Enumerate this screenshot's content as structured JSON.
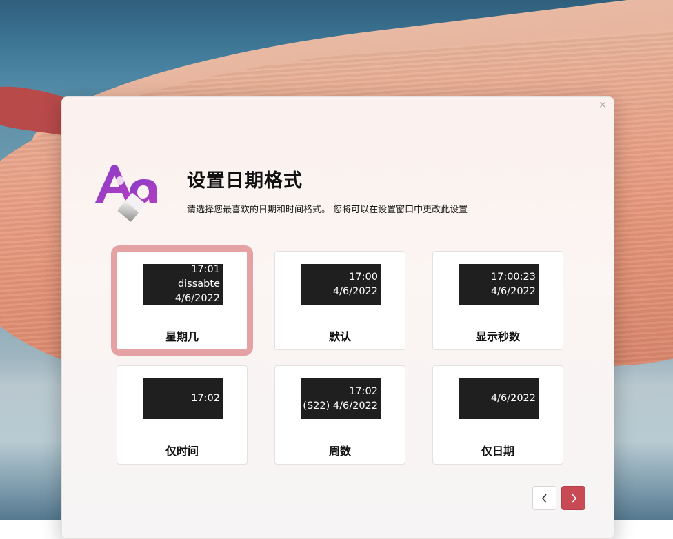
{
  "dialog": {
    "title": "设置日期格式",
    "subtitle": "请选择您最喜欢的日期和时间格式。 您将可以在设置窗口中更改此设置",
    "close_icon": "close-icon"
  },
  "options": [
    {
      "label": "星期几",
      "preview_lines": [
        "17:01",
        "dissabte",
        "4/6/2022"
      ],
      "selected": true
    },
    {
      "label": "默认",
      "preview_lines": [
        "17:00",
        "4/6/2022"
      ],
      "selected": false
    },
    {
      "label": "显示秒数",
      "preview_lines": [
        "17:00:23",
        "4/6/2022"
      ],
      "selected": false
    },
    {
      "label": "仅时间",
      "preview_lines": [
        "17:02"
      ],
      "selected": false
    },
    {
      "label": "周数",
      "preview_lines": [
        "17:02",
        "(S22) 4/6/2022"
      ],
      "selected": false
    },
    {
      "label": "仅日期",
      "preview_lines": [
        "4/6/2022"
      ],
      "selected": false
    }
  ],
  "navigation": {
    "prev_icon": "chevron-left-icon",
    "next_icon": "chevron-right-icon"
  },
  "colors": {
    "accent": "#c84a55",
    "selected_outline": "#e4a2a4",
    "preview_bg": "#1f1f1f"
  }
}
